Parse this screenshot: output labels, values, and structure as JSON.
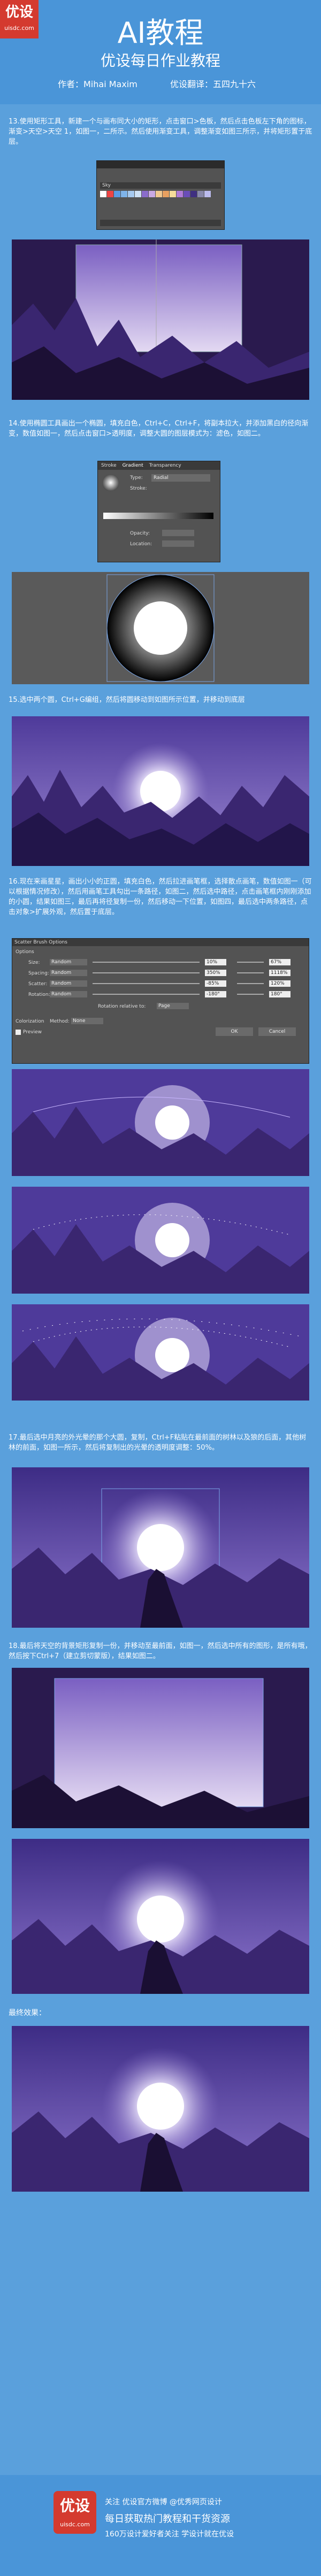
{
  "header": {
    "logo_big": "优设",
    "logo_small": "uisdc.com",
    "title": "AI教程",
    "subtitle": "优设每日作业教程",
    "author": "作者：Mihai Maxim",
    "translator": "优设翻译：五四九十六"
  },
  "steps": [
    {
      "text": "13.使用矩形工具，新建一个与画布同大小的矩形，点击窗口>色板，然后点击色板左下角的图标，渐变>天空>天空 1，如图一，二所示。然后使用渐变工具，调整渐变如图三所示，并将矩形置于底层。"
    },
    {
      "text": "14.使用椭圆工具画出一个椭圆，填充白色，Ctrl+C，Ctrl+F，将副本拉大，并添加黑白的径向渐变，数值如图一，然后点击窗口>透明度，调整大圆的图层模式为：滤色，如图二。"
    },
    {
      "text": "15.选中两个圆，Ctrl+G编组，然后将圆移动到如图所示位置，并移动到底层"
    },
    {
      "text": "16.现在来画星星，画出小小的正圆，填充白色，然后拉进画笔框，选择散点画笔，数值如图一（可以根据情况修改），然后用画笔工具勾出一条路径，如图二，然后选中路径，点击画笔框内刚刚添加的小圆，结果如图三，最后再将径复制一份，然后移动一下位置，如图四，最后选中两条路径，点击对象>扩展外观，然后置于底层。"
    },
    {
      "text": "17.最后选中月亮的外光晕的那个大圆，复制，Ctrl+F粘贴在最前面的树林以及狼的后面，其他树林的前面，如图一所示，然后将复制出的光晕的透明度调整：50%。"
    },
    {
      "text": "18.最后将天空的背景矩形复制一份，并移动至最前面，如图一，然后选中所有的图形，是所有哦，然后按下Ctrl+7（建立剪切蒙版），结果如图二。"
    }
  ],
  "panels": {
    "swatches_title": "Sky",
    "gradient_tab_1": "Stroke",
    "gradient_tab_2": "Gradient",
    "gradient_tab_3": "Transparency",
    "gradient_type_label": "Type:",
    "gradient_type_value": "Radial",
    "gradient_stroke_label": "Stroke:",
    "opacity_label": "Opacity:",
    "opacity_value": "",
    "location_label": "Location:",
    "location_value": "",
    "scatter_title": "Scatter Brush Options",
    "options_label": "Options",
    "size_label": "Size:",
    "size_mode": "Random",
    "size_val1": "10%",
    "size_val2": "67%",
    "spacing_label": "Spacing:",
    "spacing_mode": "Random",
    "spacing_val1": "350%",
    "spacing_val2": "1118%",
    "scatter_label": "Scatter:",
    "scatter_mode": "Random",
    "scatter_val1": "-85%",
    "scatter_val2": "120%",
    "rotation_label": "Rotation:",
    "rotation_mode": "Random",
    "rotation_val1": "-180°",
    "rotation_val2": "180°",
    "rotation_relative": "Rotation relative to:",
    "rotation_relative_value": "Page",
    "colorization_label": "Colorization",
    "method_label": "Method:",
    "method_value": "None",
    "preview_label": "Preview",
    "ok_label": "OK",
    "cancel_label": "Cancel"
  },
  "final_label": "最终效果：",
  "footer": {
    "logo_big": "优设",
    "logo_small": "uisdc.com",
    "line1": "关注 优设官方微博 @优秀网页设计",
    "line2": "每日获取热门教程和干货资源",
    "line3": "160万设计爱好者关注 学设计就在优设"
  },
  "colors": {
    "header_bg": "#4a95d8",
    "body_bg": "#5aa0dc",
    "sky_top": "#7a5fc2",
    "sky_bottom": "#e3d9f2",
    "tree_dark": "#2a1a4e",
    "tree_mid": "#3a2670",
    "panel_bg": "#3c3c3c",
    "logo_red": "#d43a2f"
  }
}
